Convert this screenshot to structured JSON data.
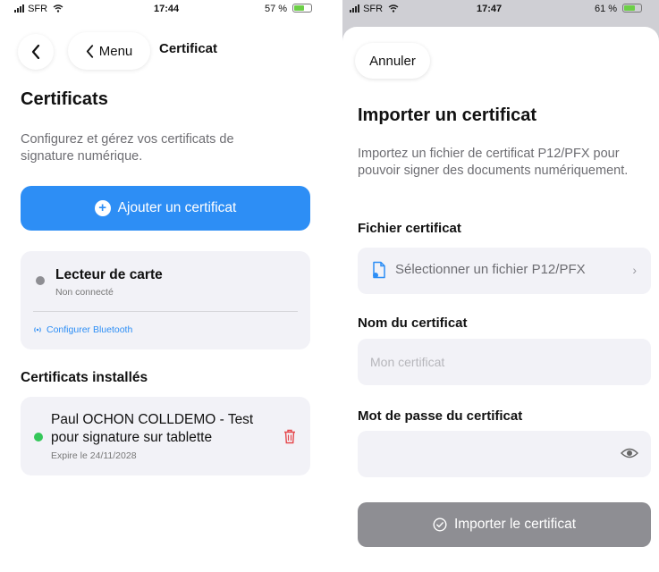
{
  "left": {
    "status_bar": {
      "carrier": "SFR",
      "time": "17:44",
      "battery": "57 %",
      "battery_level": 0.57
    },
    "nav": {
      "menu_label": "Menu",
      "title": "Certificat"
    },
    "title": "Certificats",
    "description": "Configurez et gérez vos certificats de signature numérique.",
    "add_button": "Ajouter un certificat",
    "reader": {
      "title": "Lecteur de carte",
      "status": "Non connecté",
      "status_color": "#8e8e93",
      "bluetooth_link": "Configurer Bluetooth"
    },
    "installed_title": "Certificats installés",
    "certificate": {
      "name": "Paul OCHON COLLDEMO - Test pour signature sur tablette",
      "expiry": "Expire le 24/11/2028",
      "status_color": "#34c759"
    }
  },
  "right": {
    "status_bar": {
      "carrier": "SFR",
      "time": "17:47",
      "battery": "61 %",
      "battery_level": 0.61
    },
    "cancel_button": "Annuler",
    "title": "Importer un certificat",
    "description": "Importez un fichier de certificat P12/PFX pour pouvoir signer des documents numériquement.",
    "file_label": "Fichier certificat",
    "file_select": "Sélectionner un fichier P12/PFX",
    "name_label": "Nom du certificat",
    "name_placeholder": "Mon certificat",
    "password_label": "Mot de passe du certificat",
    "import_button": "Importer le certificat"
  },
  "colors": {
    "accent": "#2d8ef5",
    "danger": "#e5484d",
    "disabled": "#8e8e93"
  },
  "icons": [
    "back-chevron-icon",
    "plus-circle-icon",
    "bluetooth-icon",
    "trash-icon",
    "file-icon",
    "chevron-right-icon",
    "eye-icon",
    "checkmark-circle-icon"
  ]
}
